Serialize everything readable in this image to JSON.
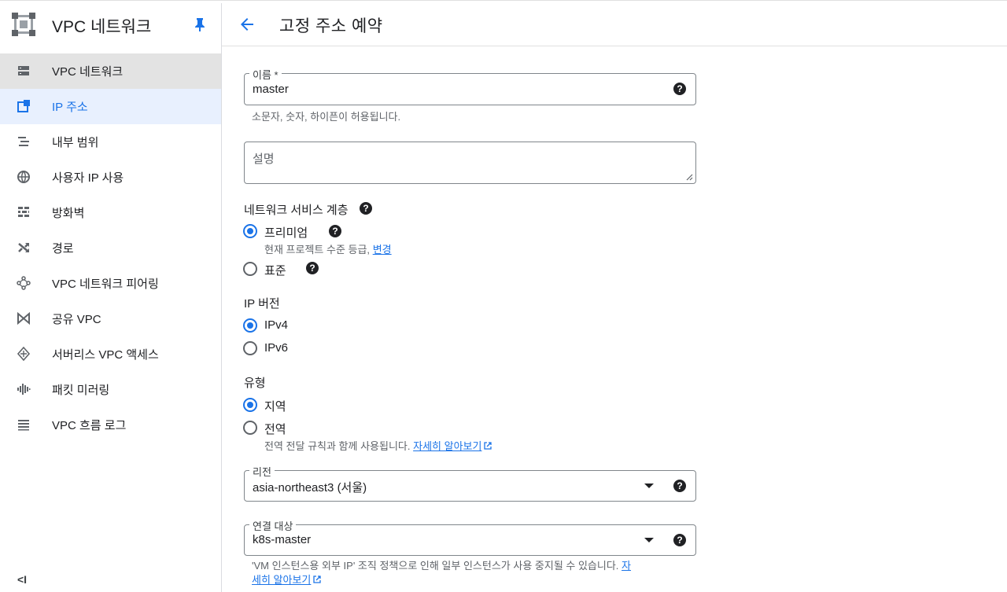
{
  "sidebar": {
    "title": "VPC 네트워크",
    "items": [
      {
        "label": "VPC 네트워크",
        "icon": "vpc-network-icon"
      },
      {
        "label": "IP 주소",
        "icon": "ip-address-icon"
      },
      {
        "label": "내부 범위",
        "icon": "internal-range-icon"
      },
      {
        "label": "사용자 IP 사용",
        "icon": "byoip-icon"
      },
      {
        "label": "방화벽",
        "icon": "firewall-icon"
      },
      {
        "label": "경로",
        "icon": "route-icon"
      },
      {
        "label": "VPC 네트워크 피어링",
        "icon": "peering-icon"
      },
      {
        "label": "공유 VPC",
        "icon": "shared-vpc-icon"
      },
      {
        "label": "서버리스 VPC 액세스",
        "icon": "serverless-icon"
      },
      {
        "label": "패킷 미러링",
        "icon": "packet-mirroring-icon"
      },
      {
        "label": "VPC 흐름 로그",
        "icon": "flow-logs-icon"
      }
    ],
    "collapse_label": "<I"
  },
  "header": {
    "title": "고정 주소 예약"
  },
  "form": {
    "name": {
      "label": "이름 *",
      "value": "master",
      "hint": "소문자, 숫자, 하이픈이 허용됩니다."
    },
    "description": {
      "placeholder": "설명"
    },
    "tier": {
      "title": "네트워크 서비스 계층",
      "premium_label": "프리미엄",
      "premium_hint": "현재 프로젝트 수준 등급,",
      "premium_link": "변경",
      "standard_label": "표준",
      "selected": "premium"
    },
    "ip_version": {
      "title": "IP 버전",
      "options": [
        "IPv4",
        "IPv6"
      ],
      "selected": "IPv4"
    },
    "type": {
      "title": "유형",
      "regional_label": "지역",
      "global_label": "전역",
      "global_hint": "전역 전달 규칙과 함께 사용됩니다.",
      "global_link": "자세히 알아보기",
      "selected": "regional"
    },
    "region": {
      "label": "리전",
      "value": "asia-northeast3 (서울)"
    },
    "attached_to": {
      "label": "연결 대상",
      "value": "k8s-master",
      "hint_line1": "'VM 인스턴스용 외부 IP' 조직 정책으로 인해 일부 인스턴스가 사용 중지될 수 있습니다.",
      "hint_link_part1": "자",
      "hint_link_part2": "세히 알아보기"
    }
  },
  "colors": {
    "accent": "#1a73e8",
    "selected_nav_bg": "#e8f0fe"
  }
}
